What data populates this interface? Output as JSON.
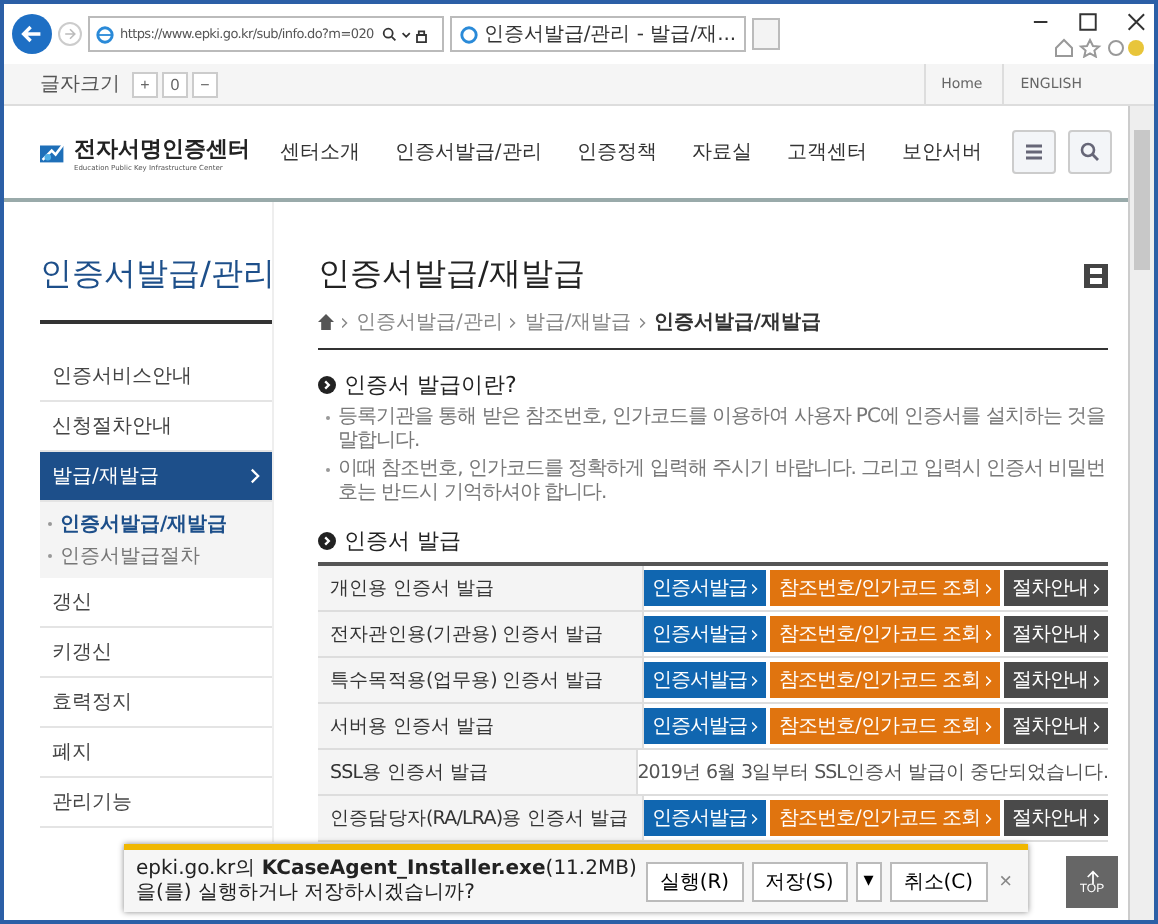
{
  "browser": {
    "url": "https://www.epki.go.kr/sub/info.do?m=020",
    "tab_title": "인증서발급/관리 - 발급/재...",
    "font_size_label": "글자크기",
    "font_size_buttons": [
      "+",
      "0",
      "−"
    ],
    "top_links": [
      "Home",
      "ENGLISH"
    ]
  },
  "header": {
    "logo_title": "전자서명인증센터",
    "logo_subtitle": "Education Public Key Infrastructure Center",
    "nav": [
      "센터소개",
      "인증서발급/관리",
      "인증정책",
      "자료실",
      "고객센터",
      "보안서버"
    ]
  },
  "sidebar": {
    "title": "인증서발급/관리",
    "items": [
      {
        "label": "인증서비스안내",
        "selected": false
      },
      {
        "label": "신청절차안내",
        "selected": false
      },
      {
        "label": "발급/재발급",
        "selected": true,
        "children": [
          {
            "label": "인증서발급/재발급",
            "selected": true
          },
          {
            "label": "인증서발급절차",
            "selected": false
          }
        ]
      },
      {
        "label": "갱신",
        "selected": false
      },
      {
        "label": "키갱신",
        "selected": false
      },
      {
        "label": "효력정지",
        "selected": false
      },
      {
        "label": "폐지",
        "selected": false
      },
      {
        "label": "관리기능",
        "selected": false
      }
    ]
  },
  "main": {
    "title": "인증서발급/재발급",
    "breadcrumb": [
      "인증서발급/관리",
      "발급/재발급",
      "인증서발급/재발급"
    ],
    "intro": {
      "heading": "인증서 발급이란?",
      "bullets": [
        "등록기관을 통해 받은 참조번호, 인가코드를 이용하여 사용자 PC에 인증서를 설치하는 것을 말합니다.",
        "이때 참조번호, 인가코드를 정확하게 입력해 주시기 바랍니다. 그리고 입력시 인증서 비밀번호는 반드시 기억하셔야 합니다."
      ]
    },
    "issue": {
      "heading": "인증서 발급",
      "rows": [
        {
          "label": "개인용 인증서 발급",
          "kind": "buttons",
          "buttons": [
            {
              "label": "인증서발급",
              "kind": "issue"
            },
            {
              "label": "참조번호/인가코드 조회",
              "kind": "lookup"
            },
            {
              "label": "절차안내",
              "kind": "guide"
            }
          ]
        },
        {
          "label": "전자관인용(기관용) 인증서 발급",
          "kind": "buttons",
          "buttons": [
            {
              "label": "인증서발급",
              "kind": "issue"
            },
            {
              "label": "참조번호/인가코드 조회",
              "kind": "lookup"
            },
            {
              "label": "절차안내",
              "kind": "guide"
            }
          ]
        },
        {
          "label": "특수목적용(업무용) 인증서 발급",
          "kind": "buttons",
          "buttons": [
            {
              "label": "인증서발급",
              "kind": "issue"
            },
            {
              "label": "참조번호/인가코드 조회",
              "kind": "lookup"
            },
            {
              "label": "절차안내",
              "kind": "guide"
            }
          ]
        },
        {
          "label": "서버용 인증서 발급",
          "kind": "buttons",
          "buttons": [
            {
              "label": "인증서발급",
              "kind": "issue"
            },
            {
              "label": "참조번호/인가코드 조회",
              "kind": "lookup"
            },
            {
              "label": "절차안내",
              "kind": "guide"
            }
          ]
        },
        {
          "label": "SSL용 인증서 발급",
          "kind": "notice",
          "notice": "2019년 6월 3일부터 SSL인증서 발급이 중단되었습니다."
        },
        {
          "label": "인증담당자(RA/LRA)용 인증서 발급",
          "kind": "buttons",
          "buttons": [
            {
              "label": "인증서발급",
              "kind": "issue"
            },
            {
              "label": "참조번호/인가코드 조회",
              "kind": "lookup"
            },
            {
              "label": "절차안내",
              "kind": "guide"
            }
          ]
        }
      ]
    }
  },
  "download_bar": {
    "message": "epki.go.kr의 **KCaseAgent_Installer.exe**(11.2MB)을(를) 실행하거나 저장하시겠습니까?",
    "buttons": [
      {
        "label": "실행(R)",
        "kind": "button"
      },
      {
        "label": "저장(S)",
        "kind": "button"
      },
      {
        "label": "▾",
        "kind": "dropdown"
      },
      {
        "label": "취소(C)",
        "kind": "button"
      },
      {
        "label": "×",
        "kind": "close"
      }
    ]
  },
  "top_button": "TOP"
}
